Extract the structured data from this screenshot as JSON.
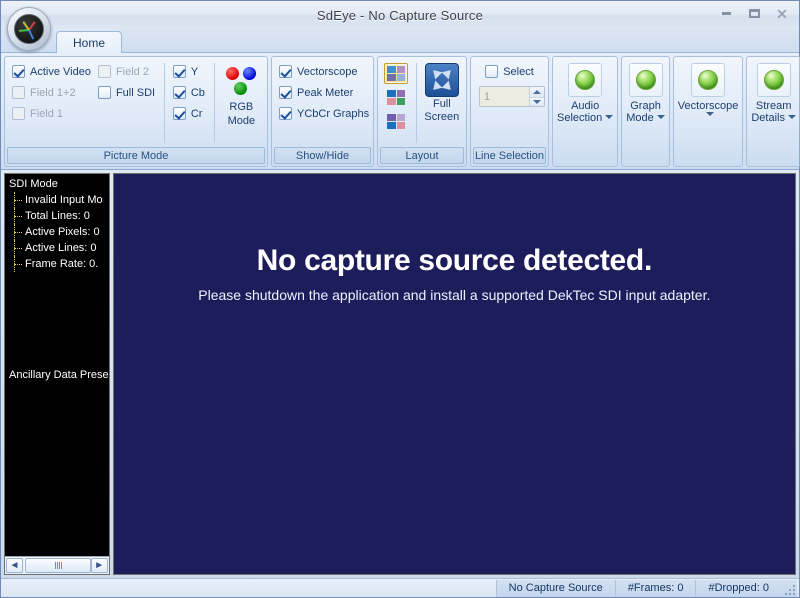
{
  "window": {
    "title": "SdEye - No Capture Source",
    "app_icon": "vectorscope-icon",
    "minimize_label": "Minimize",
    "maximize_label": "Maximize",
    "close_label": "Close"
  },
  "tabs": [
    {
      "label": "Home",
      "selected": true
    }
  ],
  "ribbon": {
    "groups": [
      {
        "label": "Picture Mode",
        "checkboxes": [
          {
            "label": "Active Video",
            "checked": true,
            "enabled": true
          },
          {
            "label": "Field 1+2",
            "checked": false,
            "enabled": false
          },
          {
            "label": "Field 1",
            "checked": false,
            "enabled": false
          },
          {
            "label": "Field 2",
            "checked": false,
            "enabled": false
          },
          {
            "label": "Full SDI",
            "checked": false,
            "enabled": true
          },
          {
            "label": "Y",
            "checked": true,
            "enabled": true
          },
          {
            "label": "Cb",
            "checked": true,
            "enabled": true
          },
          {
            "label": "Cr",
            "checked": true,
            "enabled": true
          }
        ],
        "button": {
          "line1": "RGB",
          "line2": "Mode",
          "icon": "rgb-dots-icon"
        }
      },
      {
        "label": "Show/Hide",
        "checkboxes": [
          {
            "label": "Vectorscope",
            "checked": true,
            "enabled": true
          },
          {
            "label": "Peak Meter",
            "checked": true,
            "enabled": true
          },
          {
            "label": "YCbCr Graphs",
            "checked": true,
            "enabled": true
          }
        ]
      },
      {
        "label": "Layout",
        "thumbs": [
          {
            "name": "layout-quad-1",
            "selected": true
          },
          {
            "name": "layout-quad-2",
            "selected": false
          },
          {
            "name": "layout-quad-3",
            "selected": false
          }
        ],
        "fullscreen": {
          "line1": "Full",
          "line2": "Screen",
          "icon": "fullscreen-icon"
        }
      },
      {
        "label": "Line Selection",
        "checkbox": {
          "label": "Select",
          "checked": false,
          "enabled": true
        },
        "spinner": {
          "value": "1",
          "enabled": false
        }
      }
    ],
    "orb_buttons": [
      {
        "line1": "Audio",
        "line2": "Selection",
        "icon": "green-orb-icon",
        "dropdown": true
      },
      {
        "line1": "Graph",
        "line2": "Mode",
        "icon": "green-orb-icon",
        "dropdown": true
      },
      {
        "line1": "Vectorscope",
        "line2": "",
        "icon": "green-orb-icon",
        "dropdown": true
      },
      {
        "line1": "Stream",
        "line2": "Details",
        "icon": "green-orb-icon",
        "dropdown": true
      }
    ]
  },
  "sidebar": {
    "root": "SDI Mode",
    "items": [
      "Invalid Input Mo",
      "Total Lines: 0",
      "Active Pixels: 0",
      "Active Lines: 0",
      "Frame Rate:  0."
    ],
    "footer": "Ancillary Data Prese",
    "scrollbar": {
      "left_arrow": "◄",
      "right_arrow": "►"
    }
  },
  "canvas": {
    "heading": "No capture source detected.",
    "subtext": "Please shutdown the application and install a supported DekTec SDI input adapter.",
    "background_color": "#1e1d5c"
  },
  "statusbar": {
    "cells": [
      "No Capture Source",
      "#Frames: 0",
      "#Dropped: 0"
    ]
  },
  "colors": {
    "accent": "#1d4f96",
    "ribbon_text": "#1d3f6e",
    "canvas_bg": "#1e1d5c",
    "rgb_red": "#e00000",
    "rgb_green": "#008a00",
    "rgb_blue": "#0000d8",
    "selection_gold": "#c49a31"
  }
}
